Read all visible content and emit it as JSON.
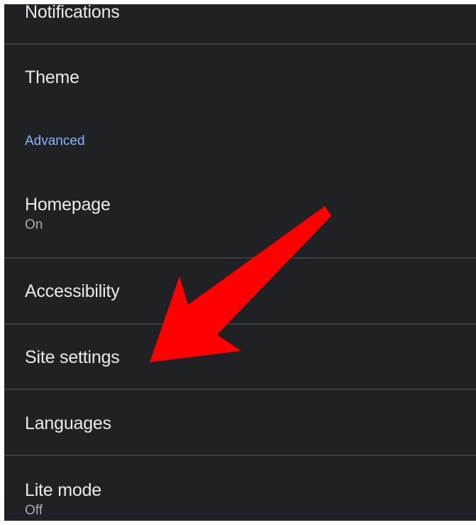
{
  "settings": {
    "items": [
      {
        "label": "Notifications"
      },
      {
        "label": "Theme"
      },
      {
        "section_header": "Advanced"
      },
      {
        "label": "Homepage",
        "status": "On"
      },
      {
        "label": "Accessibility"
      },
      {
        "label": "Site settings"
      },
      {
        "label": "Languages"
      },
      {
        "label": "Lite mode",
        "status": "Off"
      }
    ]
  },
  "annotation": {
    "arrow_color": "#ff0000",
    "points_to": "Site settings"
  },
  "colors": {
    "background": "#202124",
    "text_primary": "#e8eaed",
    "text_secondary": "#a8abb0",
    "accent": "#8ab4f8",
    "divider": "#3c3d40"
  }
}
